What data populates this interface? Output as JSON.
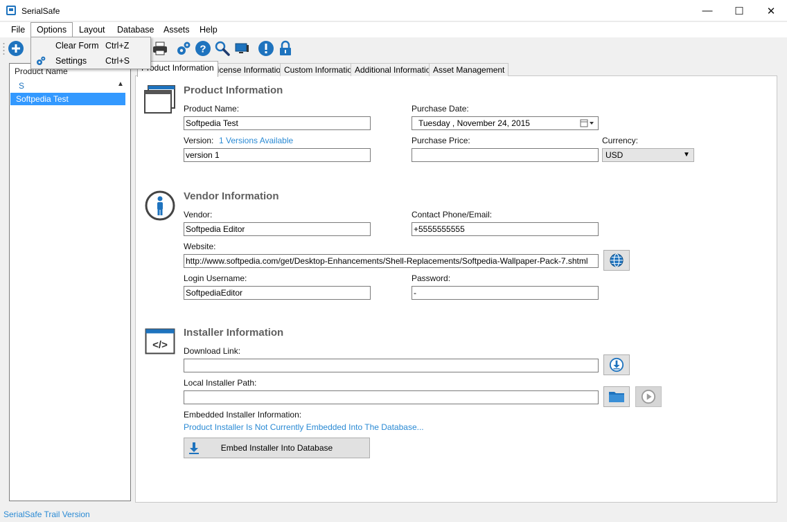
{
  "window": {
    "title": "SerialSafe",
    "minimize_glyph": "—",
    "maximize_glyph": "☐",
    "close_glyph": "✕"
  },
  "menu": {
    "file": "File",
    "options": "Options",
    "layout": "Layout",
    "database": "Database",
    "assets": "Assets",
    "help": "Help"
  },
  "options_dropdown": {
    "items": [
      {
        "label": "Clear Form",
        "shortcut": "Ctrl+Z"
      },
      {
        "label": "Settings",
        "shortcut": "Ctrl+S",
        "icon": "gears-icon"
      }
    ]
  },
  "toolbar": {
    "icons": [
      "add-icon",
      "printer-icon",
      "gears-icon",
      "help-icon",
      "search-icon",
      "monitor-icon",
      "alert-icon",
      "lock-icon"
    ]
  },
  "list": {
    "header": "Product Name",
    "group": "S",
    "selected": "Softpedia Test"
  },
  "tabs": [
    "Product Information",
    "License Information",
    "Custom Information",
    "Additional Information",
    "Asset Management"
  ],
  "product": {
    "title": "Product Information",
    "name_label": "Product Name:",
    "name_value": "Softpedia Test",
    "purchase_date_label": "Purchase Date:",
    "purchase_date_value": "Tuesday   , November 24, 2015",
    "version_label": "Version:",
    "versions_link": "1 Versions Available",
    "version_value": "version 1",
    "price_label": "Purchase Price:",
    "price_value": "",
    "currency_label": "Currency:",
    "currency_value": "USD"
  },
  "vendor": {
    "title": "Vendor Information",
    "vendor_label": "Vendor:",
    "vendor_value": "Softpedia Editor",
    "contact_label": "Contact Phone/Email:",
    "contact_value": "+5555555555",
    "website_label": "Website:",
    "website_value": "http://www.softpedia.com/get/Desktop-Enhancements/Shell-Replacements/Softpedia-Wallpaper-Pack-7.shtml",
    "login_label": "Login Username:",
    "login_value": "SoftpediaEditor",
    "password_label": "Password:",
    "password_value": "-"
  },
  "installer": {
    "title": "Installer Information",
    "download_label": "Download Link:",
    "download_value": "",
    "local_label": "Local Installer Path:",
    "local_value": "",
    "embedded_label": "Embedded Installer Information:",
    "embedded_status": "Product Installer Is Not Currently Embedded Into The Database...",
    "embed_button": "Embed Installer Into Database"
  },
  "status": "SerialSafe Trail Version",
  "colors": {
    "accent": "#1e73be",
    "link": "#2a8ad4",
    "selection": "#3399ff"
  }
}
